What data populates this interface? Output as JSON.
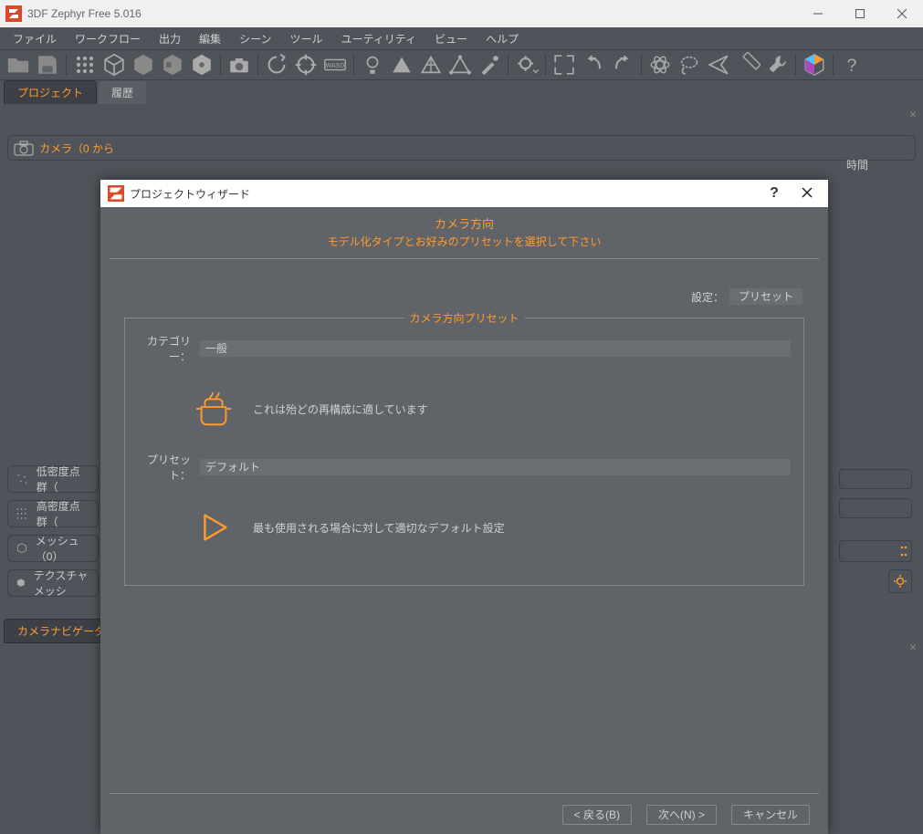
{
  "app": {
    "title": "3DF Zephyr Free 5.016"
  },
  "menu": {
    "items": [
      "ファイル",
      "ワークフロー",
      "出力",
      "編集",
      "シーン",
      "ツール",
      "ユーティリティ",
      "ビュー",
      "ヘルプ"
    ]
  },
  "tabs": {
    "project": "プロジェクト",
    "history": "履歴"
  },
  "camera_bar": {
    "label": "カメラ（0 から"
  },
  "time_label": "時間",
  "density": {
    "low": "低密度点群（",
    "high": "高密度点群（",
    "mesh": "メッシュ（0）",
    "tex": "テクスチャメッシ"
  },
  "bottom_tab": "カメラナビゲーター",
  "dialog": {
    "title": "プロジェクトウィザード",
    "header_title": "カメラ方向",
    "header_sub": "モデル化タイプとお好みのプリセットを選択して下さい",
    "settings_label": "設定：",
    "settings_value": "プリセット",
    "fieldset_legend": "カメラ方向プリセット",
    "category_label": "カテゴリー：",
    "category_value": "一般",
    "category_desc": "これは殆どの再構成に適しています",
    "preset_label": "プリセット：",
    "preset_value": "デフォルト",
    "preset_desc": "最も使用される場合に対して適切なデフォルト設定",
    "footer": {
      "back": "< 戻る(B)",
      "next": "次へ(N) >",
      "cancel": "キャンセル"
    }
  }
}
